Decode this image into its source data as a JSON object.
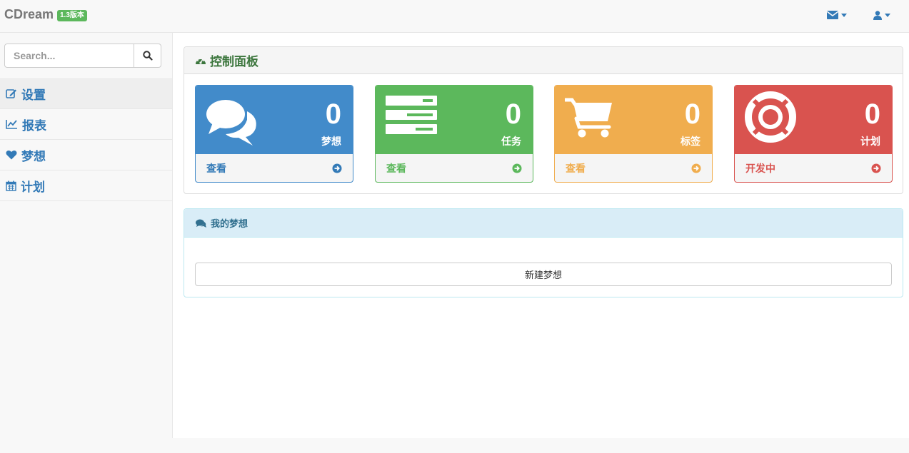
{
  "header": {
    "brand": "CDream",
    "version": "1.3版本"
  },
  "sidebar": {
    "search_placeholder": "Search...",
    "items": [
      {
        "label": "设置",
        "icon": "edit-icon"
      },
      {
        "label": "报表",
        "icon": "line-chart-icon"
      },
      {
        "label": "梦想",
        "icon": "heart-icon"
      },
      {
        "label": "计划",
        "icon": "calendar-icon"
      }
    ]
  },
  "dashboard": {
    "title": "控制面板",
    "cards": [
      {
        "count": "0",
        "label": "梦想",
        "link": "查看",
        "color": "#428bca",
        "icon": "comments-icon"
      },
      {
        "count": "0",
        "label": "任务",
        "link": "查看",
        "color": "#5cb85c",
        "icon": "tasks-icon"
      },
      {
        "count": "0",
        "label": "标签",
        "link": "查看",
        "color": "#f0ad4e",
        "icon": "shopping-cart-icon"
      },
      {
        "count": "0",
        "label": "计划",
        "link": "开发中",
        "color": "#d9534f",
        "icon": "life-ring-icon"
      }
    ]
  },
  "dreams": {
    "title": "我的梦想",
    "new_button": "新建梦想"
  }
}
